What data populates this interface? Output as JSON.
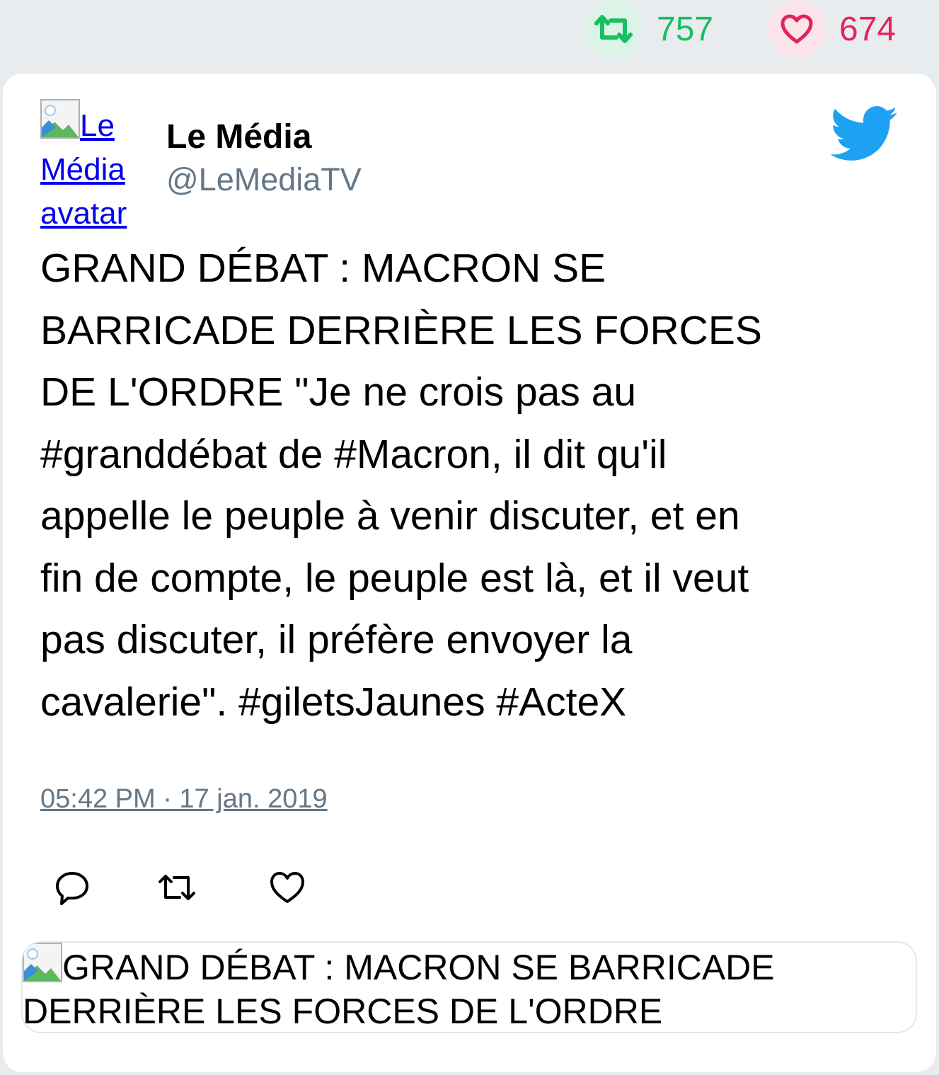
{
  "stats": {
    "retweets": "757",
    "likes": "674"
  },
  "author": {
    "avatar_alt": "Le Média avatar",
    "name": "Le Média",
    "handle": "@LeMediaTV"
  },
  "tweet": {
    "text": "GRAND DÉBAT : MACRON SE\nBARRICADE DERRIÈRE LES FORCES\nDE L'ORDRE \"Je ne crois pas au\n#granddébat de #Macron, il dit qu'il\nappelle le peuple à venir discuter, et en\nfin de compte, le peuple est là, et il veut\npas discuter, il préfère envoyer la\ncavalerie\". #giletsJaunes #ActeX",
    "timestamp": "05:42 PM · 17 jan. 2019"
  },
  "preview": {
    "title": "GRAND DÉBAT : MACRON SE BARRICADE DERRIÈRE LES FORCES DE L'ORDRE"
  },
  "colors": {
    "retweet": "#17bf63",
    "like": "#e0245e",
    "twitter_blue": "#1da1f2",
    "muted": "#657786"
  },
  "icons": {
    "retweet": "retweet-icon",
    "like": "heart-icon",
    "reply": "reply-icon",
    "logo": "twitter-bird-icon"
  }
}
